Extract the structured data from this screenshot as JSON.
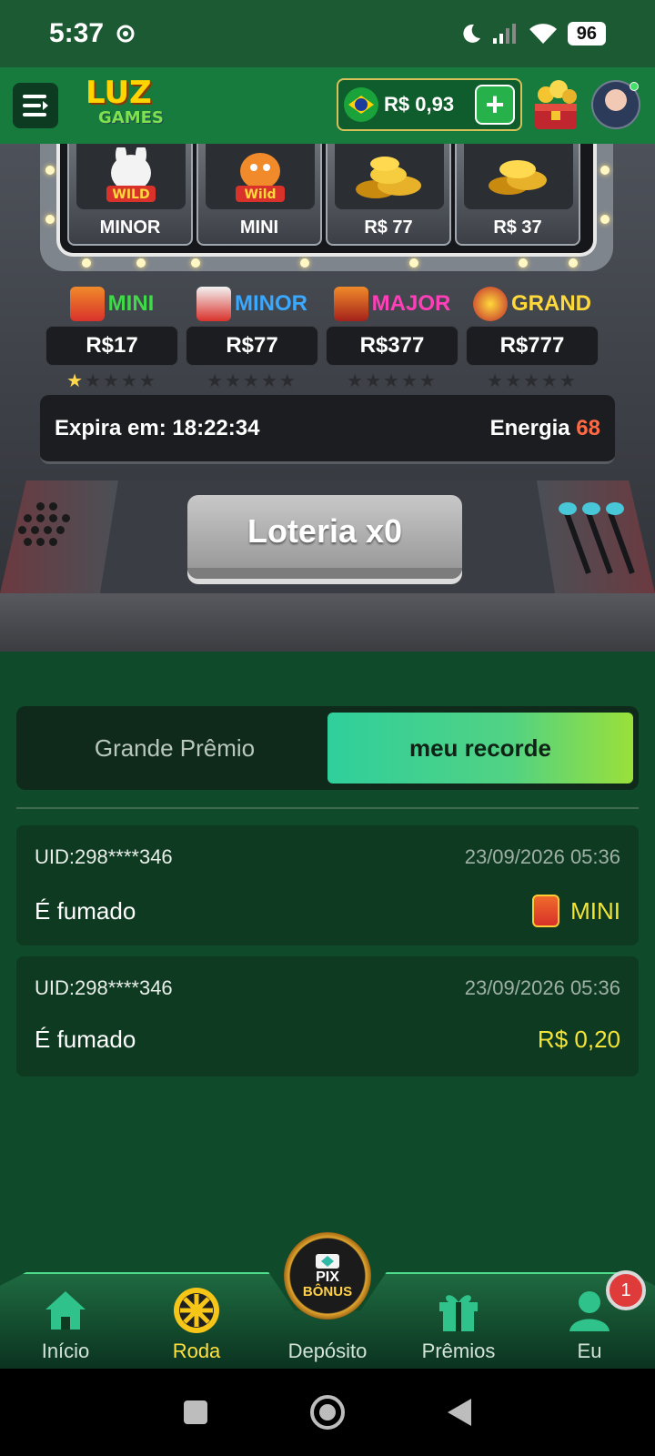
{
  "status_bar": {
    "time": "5:37",
    "battery": "96"
  },
  "header": {
    "logo_main": "LUZ",
    "logo_sub": "GAMES",
    "balance": "R$ 0,93",
    "plus_label": "+"
  },
  "reels": [
    {
      "label": "MINOR",
      "icon": "wild-rabbit-icon"
    },
    {
      "label": "MINI",
      "icon": "wild-dragon-icon"
    },
    {
      "label": "R$ 77",
      "icon": "gold-coins-icon"
    },
    {
      "label": "R$ 37",
      "icon": "gold-coins-icon"
    }
  ],
  "jackpots": [
    {
      "name": "MINI",
      "amount": "R$17",
      "stars_on": 1,
      "color": "#3fd94a"
    },
    {
      "name": "MINOR",
      "amount": "R$77",
      "stars_on": 0,
      "color": "#3aa8ff"
    },
    {
      "name": "MAJOR",
      "amount": "R$377",
      "stars_on": 0,
      "color": "#ff3fb8"
    },
    {
      "name": "GRAND",
      "amount": "R$777",
      "stars_on": 0,
      "color": "#ffd93b"
    }
  ],
  "info": {
    "expires_label": "Expira em: 18:22:34",
    "energy_label": "Energia",
    "energy_value": "68"
  },
  "lottery_button": "Loteria x0",
  "tabs": [
    {
      "label": "Grande Prêmio",
      "active": false
    },
    {
      "label": "meu recorde",
      "active": true
    }
  ],
  "records": [
    {
      "uid": "UID:298****346",
      "date": "23/09/2026 05:36",
      "label": "É fumado",
      "prize": "MINI",
      "has_icon": true
    },
    {
      "uid": "UID:298****346",
      "date": "23/09/2026 05:36",
      "label": "É fumado",
      "prize": "R$ 0,20",
      "has_icon": false
    }
  ],
  "bottom_nav": [
    {
      "label": "Início",
      "icon": "home-icon",
      "active": false
    },
    {
      "label": "Roda",
      "icon": "wheel-icon",
      "active": true
    },
    {
      "label": "Depósito",
      "icon": "pix-bonus-icon",
      "active": false
    },
    {
      "label": "Prêmios",
      "icon": "gift-icon",
      "active": false
    },
    {
      "label": "Eu",
      "icon": "user-icon",
      "active": false
    }
  ],
  "pix_button": {
    "top": "PIX",
    "bottom": "BÔNUS"
  },
  "notification_badge": "1"
}
